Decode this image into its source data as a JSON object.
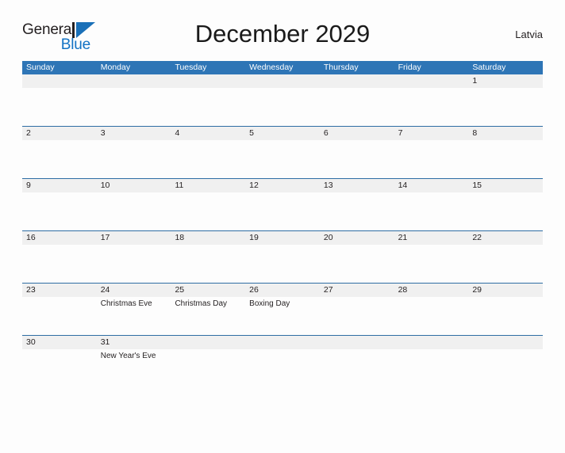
{
  "brand": {
    "name_part1": "General",
    "name_part2": "Blue",
    "mark_icon": "triangle-flag-icon"
  },
  "header": {
    "title": "December 2029",
    "locale": "Latvia"
  },
  "colors": {
    "header_blue": "#2e75b6",
    "rule_blue": "#2e6da4",
    "number_band": "#f0f0f0",
    "brand_blue": "#1272c4",
    "page_background": "#fdfdfd"
  },
  "calendar": {
    "day_headers": [
      "Sunday",
      "Monday",
      "Tuesday",
      "Wednesday",
      "Thursday",
      "Friday",
      "Saturday"
    ],
    "weeks": [
      {
        "days": [
          {
            "number": "",
            "event": ""
          },
          {
            "number": "",
            "event": ""
          },
          {
            "number": "",
            "event": ""
          },
          {
            "number": "",
            "event": ""
          },
          {
            "number": "",
            "event": ""
          },
          {
            "number": "",
            "event": ""
          },
          {
            "number": "1",
            "event": ""
          }
        ]
      },
      {
        "days": [
          {
            "number": "2",
            "event": ""
          },
          {
            "number": "3",
            "event": ""
          },
          {
            "number": "4",
            "event": ""
          },
          {
            "number": "5",
            "event": ""
          },
          {
            "number": "6",
            "event": ""
          },
          {
            "number": "7",
            "event": ""
          },
          {
            "number": "8",
            "event": ""
          }
        ]
      },
      {
        "days": [
          {
            "number": "9",
            "event": ""
          },
          {
            "number": "10",
            "event": ""
          },
          {
            "number": "11",
            "event": ""
          },
          {
            "number": "12",
            "event": ""
          },
          {
            "number": "13",
            "event": ""
          },
          {
            "number": "14",
            "event": ""
          },
          {
            "number": "15",
            "event": ""
          }
        ]
      },
      {
        "days": [
          {
            "number": "16",
            "event": ""
          },
          {
            "number": "17",
            "event": ""
          },
          {
            "number": "18",
            "event": ""
          },
          {
            "number": "19",
            "event": ""
          },
          {
            "number": "20",
            "event": ""
          },
          {
            "number": "21",
            "event": ""
          },
          {
            "number": "22",
            "event": ""
          }
        ]
      },
      {
        "days": [
          {
            "number": "23",
            "event": ""
          },
          {
            "number": "24",
            "event": "Christmas Eve"
          },
          {
            "number": "25",
            "event": "Christmas Day"
          },
          {
            "number": "26",
            "event": "Boxing Day"
          },
          {
            "number": "27",
            "event": ""
          },
          {
            "number": "28",
            "event": ""
          },
          {
            "number": "29",
            "event": ""
          }
        ]
      },
      {
        "days": [
          {
            "number": "30",
            "event": ""
          },
          {
            "number": "31",
            "event": "New Year's Eve"
          },
          {
            "number": "",
            "event": ""
          },
          {
            "number": "",
            "event": ""
          },
          {
            "number": "",
            "event": ""
          },
          {
            "number": "",
            "event": ""
          },
          {
            "number": "",
            "event": ""
          }
        ]
      }
    ]
  }
}
